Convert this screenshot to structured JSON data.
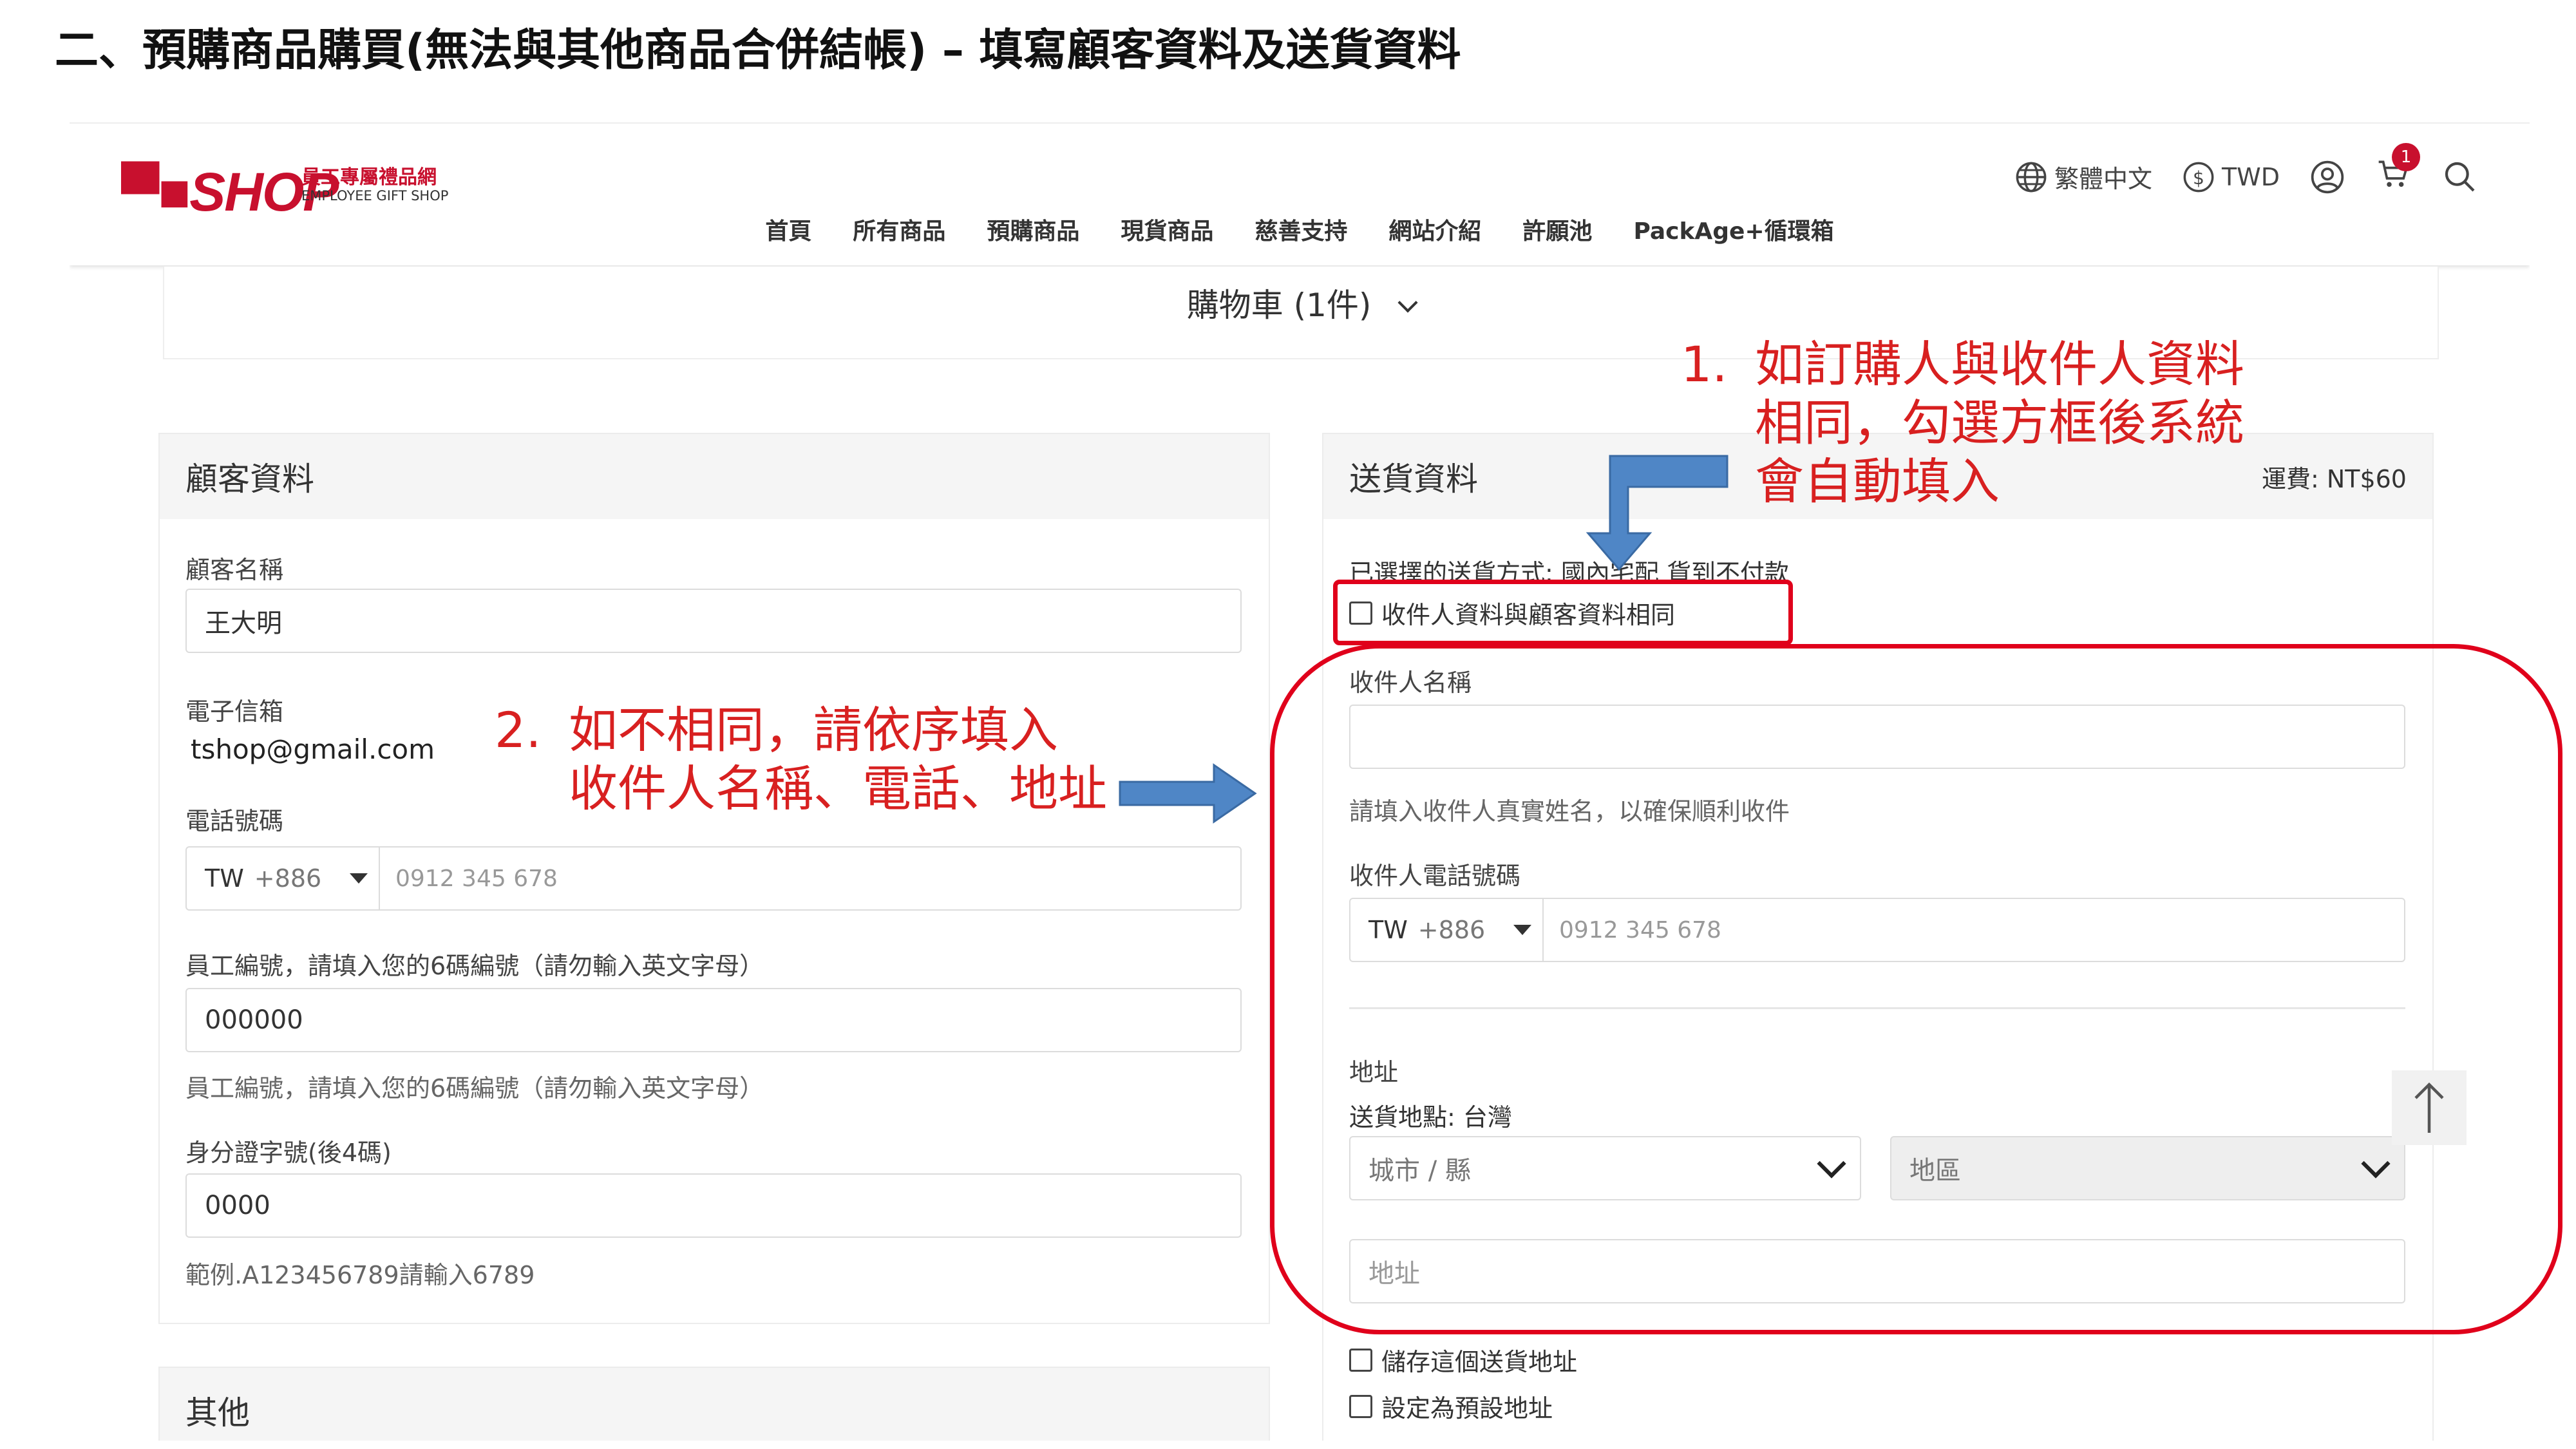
{
  "slide_title": "二、預購商品購買(無法與其他商品合併結帳) – 填寫顧客資料及送貨資料",
  "header": {
    "logo_text": "SHOP",
    "logo_sub_cn": "員工專屬禮品網",
    "logo_sub_en": "EMPLOYEE GIFT SHOP",
    "language": "繁體中文",
    "currency": "TWD",
    "cart_count": "1",
    "nav": [
      "首頁",
      "所有商品",
      "預購商品",
      "現貨商品",
      "慈善支持",
      "網站介紹",
      "許願池",
      "PackAge+循環箱"
    ]
  },
  "cart_summary": "購物車 (1件)",
  "customer": {
    "title": "顧客資料",
    "name_label": "顧客名稱",
    "name_value": "王大明",
    "email_label": "電子信箱",
    "email_value": "tshop@gmail.com",
    "phone_label": "電話號碼",
    "phone_country": "TW",
    "phone_code": "+886",
    "phone_placeholder": "0912 345 678",
    "employee_label": "員工編號，請填入您的6碼編號（請勿輸入英文字母）",
    "employee_value": "000000",
    "employee_hint": "員工編號，請填入您的6碼編號（請勿輸入英文字母）",
    "id_label": "身分證字號(後4碼)",
    "id_value": "0000",
    "id_hint": "範例.A123456789請輸入6789"
  },
  "other": {
    "title": "其他"
  },
  "shipping": {
    "title": "送貨資料",
    "fee": "運費: NT$60",
    "method": "已選擇的送貨方式: 國內宅配 貨到不付款",
    "same_as_customer": "收件人資料與顧客資料相同",
    "recipient_label": "收件人名稱",
    "recipient_hint": "請填入收件人真實姓名，以確保順利收件",
    "recipient_phone_label": "收件人電話號碼",
    "phone_country": "TW",
    "phone_code": "+886",
    "phone_placeholder": "0912 345 678",
    "address_label": "地址",
    "ship_location": "送貨地點: 台灣",
    "city_placeholder": "城市 / 縣",
    "district_placeholder": "地區",
    "address_placeholder": "地址",
    "save_address": "儲存這個送貨地址",
    "set_default": "設定為預設地址"
  },
  "annotations": {
    "a1_num": "1.",
    "a1_lines": [
      "如訂購人與收件人資料",
      "相同，勾選方框後系統",
      "會自動填入"
    ],
    "a2_num": "2.",
    "a2_lines": [
      "如不相同，請依序填入",
      "收件人名稱、電話、地址"
    ]
  },
  "colors": {
    "brand_red": "#c8102e",
    "annotation_red": "#d82020",
    "arrow_blue": "#4f86c6"
  }
}
